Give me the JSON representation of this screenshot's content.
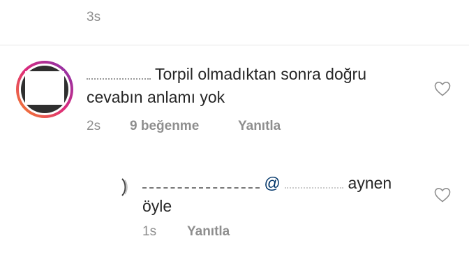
{
  "top_comment": {
    "time": "3s"
  },
  "comment": {
    "username": "",
    "text_line1": "Torpil olmadıktan sonra doğru",
    "text_line2": "cevabın anlamı yok",
    "time": "2s",
    "likes": "9 beğenme",
    "reply_label": "Yanıtla"
  },
  "reply": {
    "username": "",
    "mention": "@",
    "text_a": "aynen",
    "text_b": "öyle",
    "time": "1s",
    "reply_label": "Yanıtla"
  },
  "icons": {
    "like": "heart-outline-icon",
    "avatar_ring_colors": [
      "#f58529",
      "#dd2a7b",
      "#8134af"
    ]
  }
}
